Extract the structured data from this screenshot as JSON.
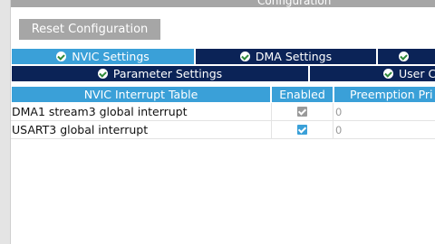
{
  "header": {
    "title": "Configuration"
  },
  "toolbar": {
    "reset_label": "Reset Configuration"
  },
  "tabs_row1": [
    {
      "label": "NVIC Settings",
      "active": true
    },
    {
      "label": "DMA Settings",
      "active": false
    },
    {
      "label": "",
      "active": false
    }
  ],
  "tabs_row2": [
    {
      "label": "Parameter Settings",
      "active": false
    },
    {
      "label": "User C",
      "active": false
    }
  ],
  "table": {
    "columns": [
      "NVIC Interrupt Table",
      "Enabled",
      "Preemption Pri"
    ],
    "rows": [
      {
        "name": "DMA1 stream3 global interrupt",
        "enabled": true,
        "editable": false,
        "priority": "0"
      },
      {
        "name": "USART3 global interrupt",
        "enabled": true,
        "editable": true,
        "priority": "0"
      }
    ]
  },
  "colors": {
    "accent": "#3aa0d8",
    "tab_dark": "#0b2357",
    "button_grey": "#a6a6a6"
  }
}
